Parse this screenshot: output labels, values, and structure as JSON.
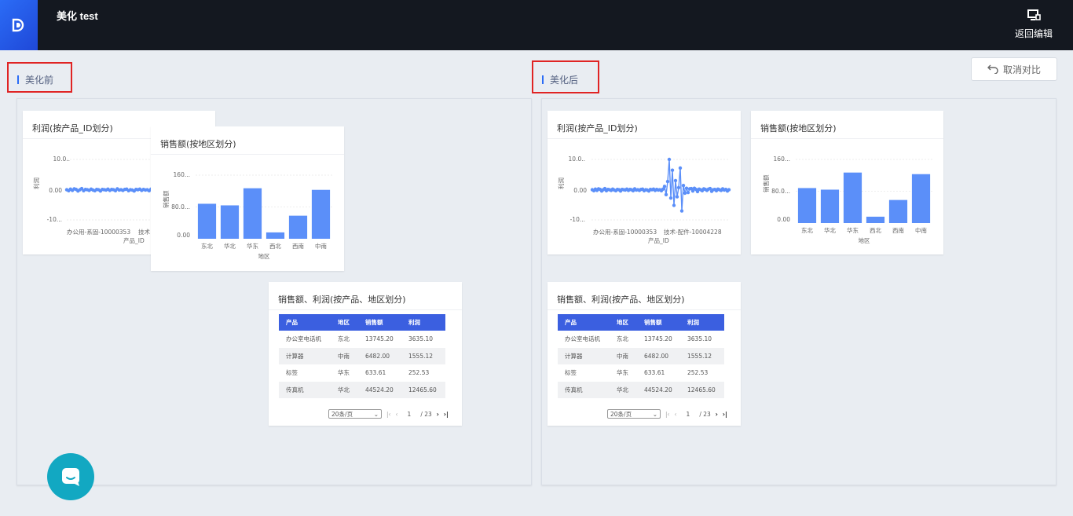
{
  "app": {
    "title": "美化 test",
    "back_label": "返回编辑"
  },
  "left": {
    "label": "美化前"
  },
  "right": {
    "label": "美化后"
  },
  "cancel_label": "取消对比",
  "profit_chart": {
    "title": "利润(按产品_ID划分)",
    "ylabel": "利润",
    "xlabel": "产品_ID",
    "ticks_y": [
      "10.0..",
      "0.00",
      "-10..."
    ],
    "tick_x1": "办公用-系固-10000353",
    "tick_x2_short": "技术",
    "tick_x2": "技术-配件-10004228"
  },
  "sales_chart": {
    "title": "销售额(按地区划分)",
    "ylabel": "销售额",
    "xlabel": "地区",
    "ticks_y": [
      "160...",
      "80.0...",
      "0.00"
    ]
  },
  "table": {
    "title": "销售额、利润(按产品、地区划分)",
    "headers": [
      "产品",
      "地区",
      "销售额",
      "利润"
    ],
    "rows": [
      [
        "办公室电话机",
        "东北",
        "13745.20",
        "3635.10"
      ],
      [
        "计算器",
        "中南",
        "6482.00",
        "1555.12"
      ],
      [
        "标签",
        "华东",
        "633.61",
        "252.53"
      ],
      [
        "传真机",
        "华北",
        "44524.20",
        "12465.60"
      ]
    ],
    "page_size": "20条/页",
    "page": "1",
    "total_pages": "/ 23"
  },
  "chart_data": [
    {
      "type": "bar",
      "title": "销售额(按地区划分)",
      "xlabel": "地区",
      "ylabel": "销售额",
      "categories": [
        "东北",
        "华北",
        "华东",
        "西北",
        "西南",
        "中南"
      ],
      "values": [
        88,
        84,
        127,
        16,
        58,
        123
      ],
      "ylim": [
        0,
        160
      ],
      "ticks": [
        "160...",
        "80.0...",
        "0.00"
      ],
      "grid": true,
      "color": "#5b8ff9"
    },
    {
      "type": "line",
      "title": "利润(按产品_ID划分)",
      "xlabel": "产品_ID",
      "ylabel": "利润",
      "ylim": [
        -10,
        10
      ],
      "ticks": [
        "10.0..",
        "0.00",
        "-10..."
      ],
      "x_tick_labels": [
        "办公用-系固-10000353",
        "技术-配件-10004228"
      ],
      "values": [
        0.1,
        -0.2,
        0.3,
        -0.1,
        0.4,
        0.2,
        -0.3,
        0.1,
        0.5,
        -0.2,
        0.2,
        0.1,
        -0.1,
        0.3,
        0.0,
        -0.2,
        0.2,
        0.1,
        -0.3,
        0.2,
        0.1,
        0.0,
        0.3,
        -0.1,
        0.2,
        0.1,
        -0.2,
        0.4,
        0.0,
        0.1,
        -0.1,
        0.2,
        0.3,
        -0.2,
        0.1,
        0.0,
        -0.3,
        0.2,
        0.1,
        0.3,
        -0.1,
        0.2,
        0.0,
        0.1,
        -0.2,
        0.3,
        1.2,
        -1.5,
        2.8,
        10.0,
        -2.6,
        6.5,
        -5.0,
        3.1,
        -2.2,
        0.8,
        7.2,
        -6.8,
        1.5,
        -1.0,
        0.6,
        -0.8,
        0.4,
        0.5,
        -0.3,
        0.6,
        0.2,
        -0.5,
        0.3,
        0.1,
        -0.2,
        0.4,
        0.2,
        -0.1,
        0.3,
        0.5,
        -0.4,
        0.1,
        0.2,
        -0.2,
        0.3,
        0.1,
        -0.1,
        0.4,
        0.0,
        0.2,
        -0.3,
        0.1
      ],
      "color": "#5b8ff9"
    }
  ],
  "colors": {
    "accent": "#2b6cf6",
    "bar": "#5b8ff9",
    "table_header": "#3b5fe0",
    "chat": "#12a8c2",
    "highlight_box": "#e02424"
  },
  "icons": {
    "logo": "brand-logo-icon",
    "back": "monitor-edit-icon",
    "undo": "undo-icon",
    "chat": "chat-icon"
  }
}
